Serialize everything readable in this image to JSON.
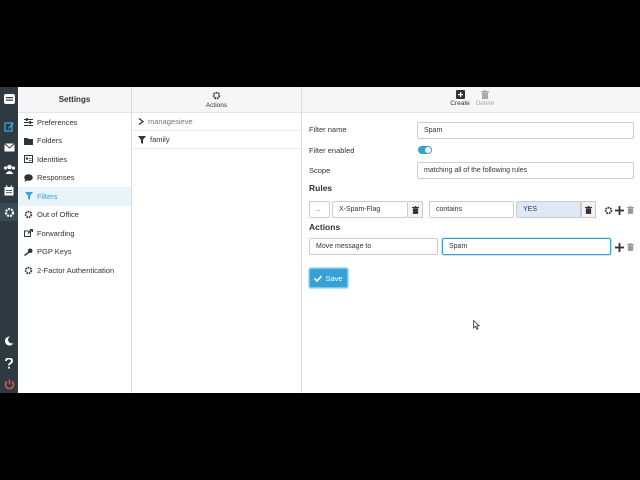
{
  "colors": {
    "accent": "#37a1d6",
    "rail": "#2f3a40",
    "logout": "#e2534b"
  },
  "rail": {
    "icons": [
      "mail-logo-icon",
      "compose-icon",
      "mail-icon",
      "contacts-icon",
      "calendar-icon",
      "settings-icon",
      "dark-mode-icon",
      "help-icon",
      "power-icon"
    ]
  },
  "settings": {
    "title": "Settings",
    "items": [
      {
        "label": "Preferences",
        "icon": "sliders-icon"
      },
      {
        "label": "Folders",
        "icon": "folder-icon"
      },
      {
        "label": "Identities",
        "icon": "id-card-icon"
      },
      {
        "label": "Responses",
        "icon": "comment-icon"
      },
      {
        "label": "Filters",
        "icon": "filter-icon",
        "selected": true
      },
      {
        "label": "Out of Office",
        "icon": "gear-icon"
      },
      {
        "label": "Forwarding",
        "icon": "share-icon"
      },
      {
        "label": "PGP Keys",
        "icon": "key-icon"
      },
      {
        "label": "2-Factor Authentication",
        "icon": "cog-icon"
      }
    ]
  },
  "sets": {
    "actions_label": "Actions",
    "group": "managesieve",
    "filters": [
      "family"
    ]
  },
  "toolbar": {
    "create": "Create",
    "delete": "Delete"
  },
  "form": {
    "filter_name_label": "Filter name",
    "filter_name_value": "Spam",
    "filter_enabled_label": "Filter enabled",
    "scope_label": "Scope",
    "scope_value": "matching all of the following rules",
    "rules_heading": "Rules",
    "rule": {
      "prefix": "..",
      "header": "X-Spam-Flag",
      "operator": "contains",
      "value": "YES"
    },
    "actions_heading": "Actions",
    "action": {
      "type": "Move message to",
      "target": "Spam"
    },
    "save_label": "Save"
  }
}
